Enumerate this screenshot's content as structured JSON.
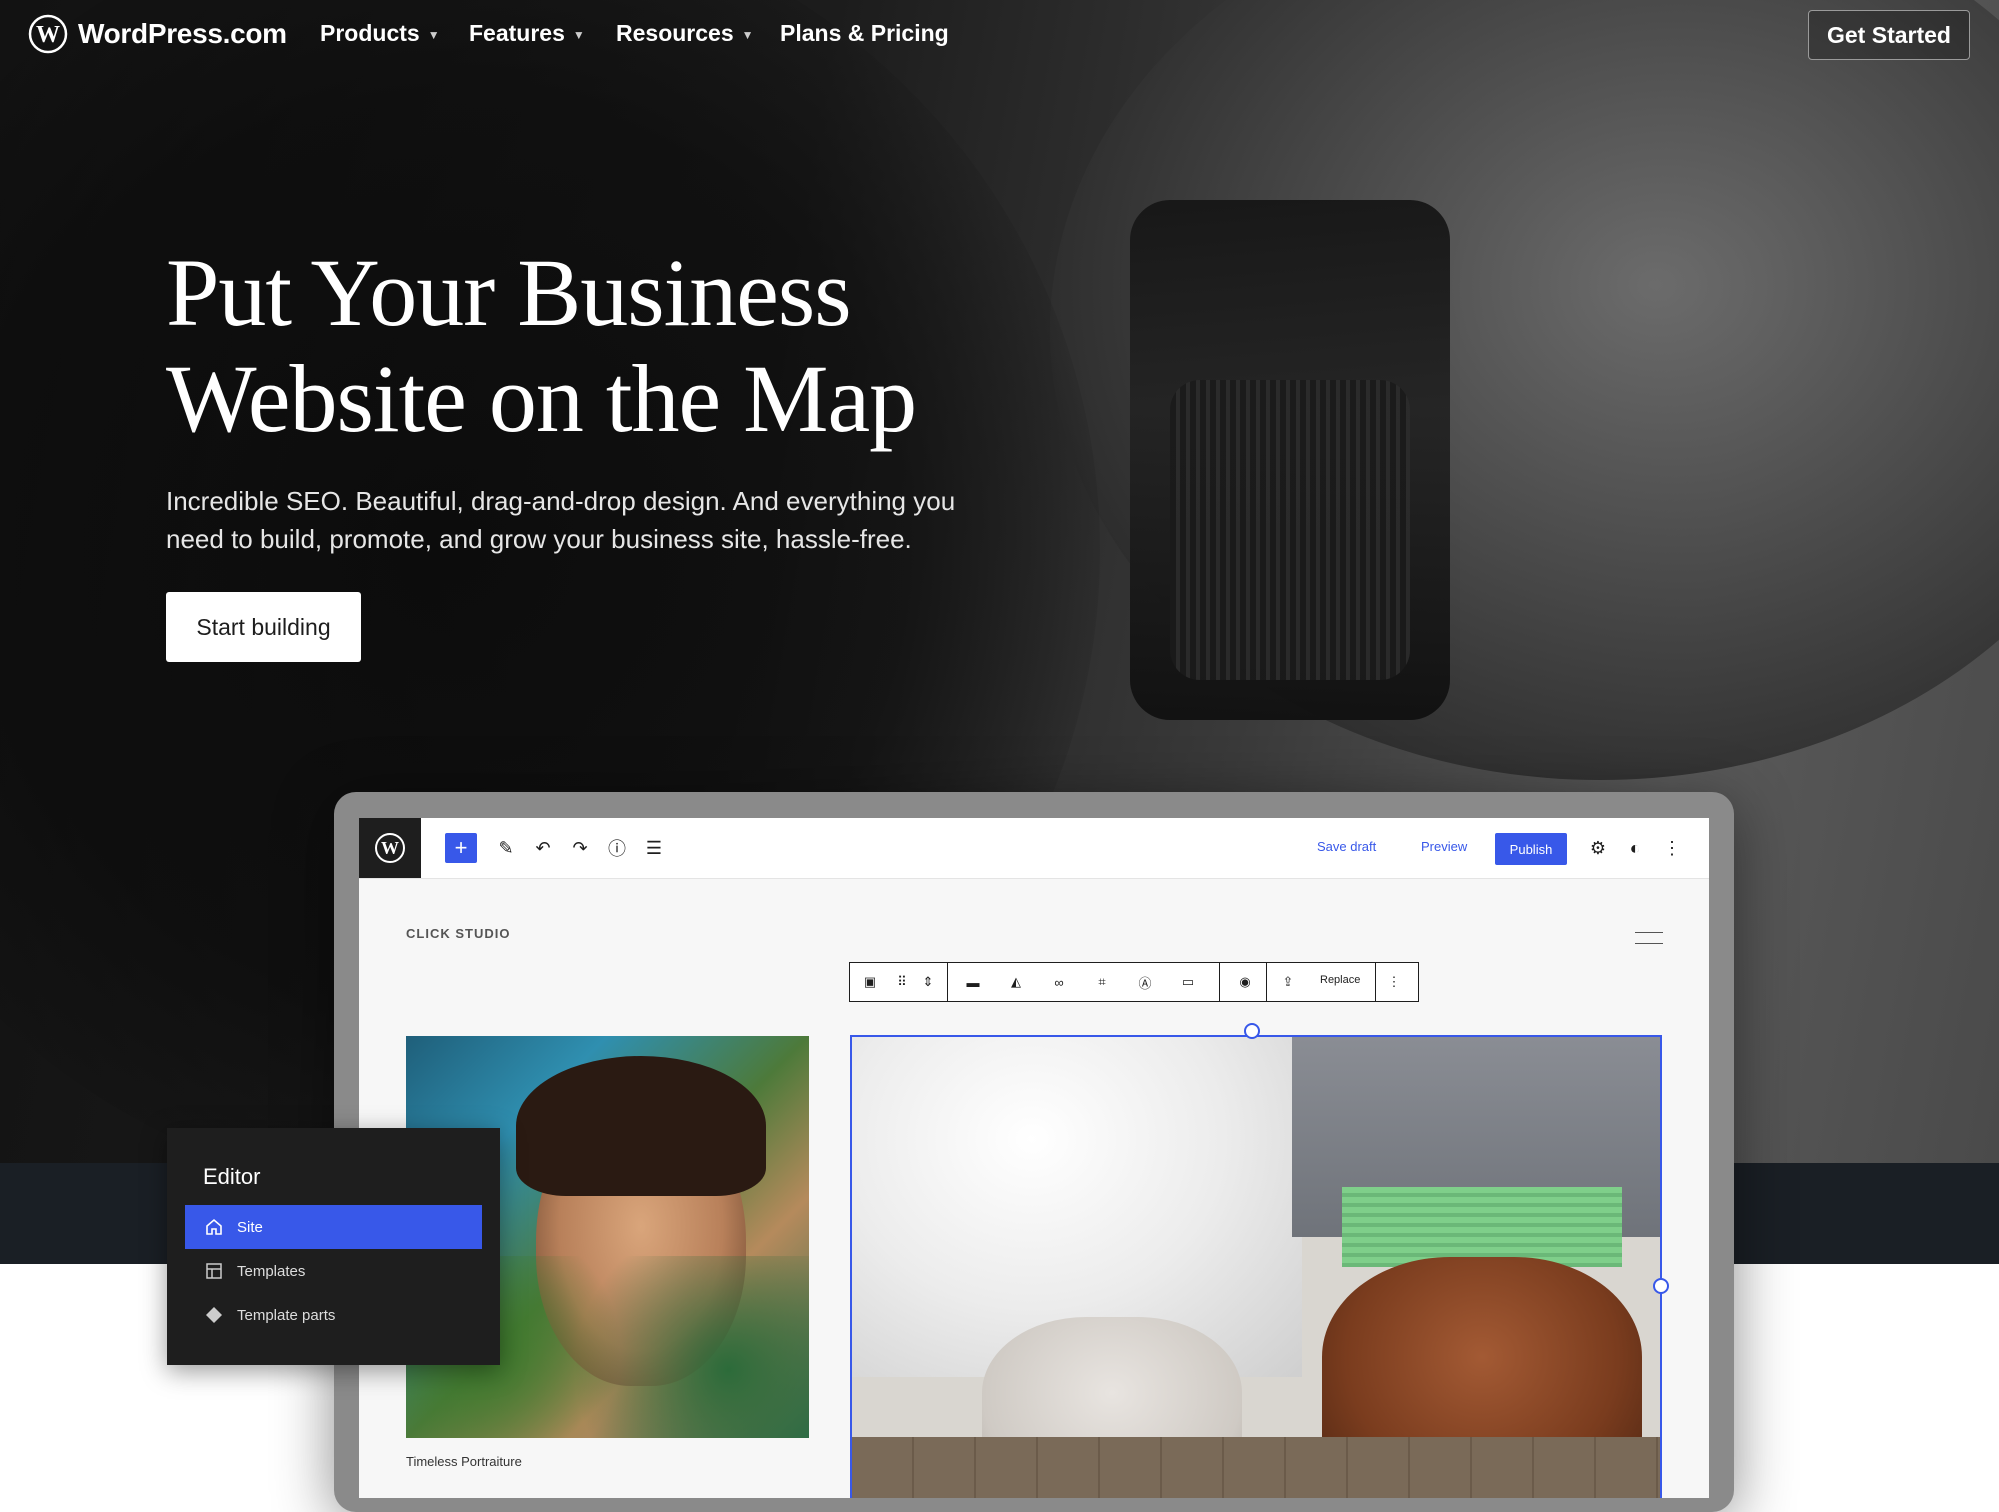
{
  "nav": {
    "brand": "WordPress.com",
    "items": [
      {
        "label": "Products",
        "dropdown": true
      },
      {
        "label": "Features",
        "dropdown": true
      },
      {
        "label": "Resources",
        "dropdown": true
      },
      {
        "label": "Plans & Pricing",
        "dropdown": false
      }
    ],
    "cta": "Get Started"
  },
  "hero": {
    "headline_line1": "Put Your Business",
    "headline_line2": "Website on the Map",
    "subtext": "Incredible SEO. Beautiful, drag-and-drop design. And everything you need to build, promote, and grow your business site, hassle-free.",
    "button": "Start building"
  },
  "editor_mockup": {
    "toolbar": {
      "save_draft": "Save draft",
      "preview": "Preview",
      "publish": "Publish"
    },
    "site_title": "CLICK STUDIO",
    "block_toolbar": {
      "replace": "Replace"
    },
    "caption": "Timeless Portraiture"
  },
  "editor_panel": {
    "title": "Editor",
    "items": [
      {
        "label": "Site",
        "icon": "home-icon",
        "active": true
      },
      {
        "label": "Templates",
        "icon": "layout-icon",
        "active": false
      },
      {
        "label": "Template parts",
        "icon": "diamond-icon",
        "active": false
      }
    ]
  },
  "colors": {
    "accent": "#3858e9",
    "hero_bg": "#1c1c1c",
    "band": "#1a1f25"
  }
}
